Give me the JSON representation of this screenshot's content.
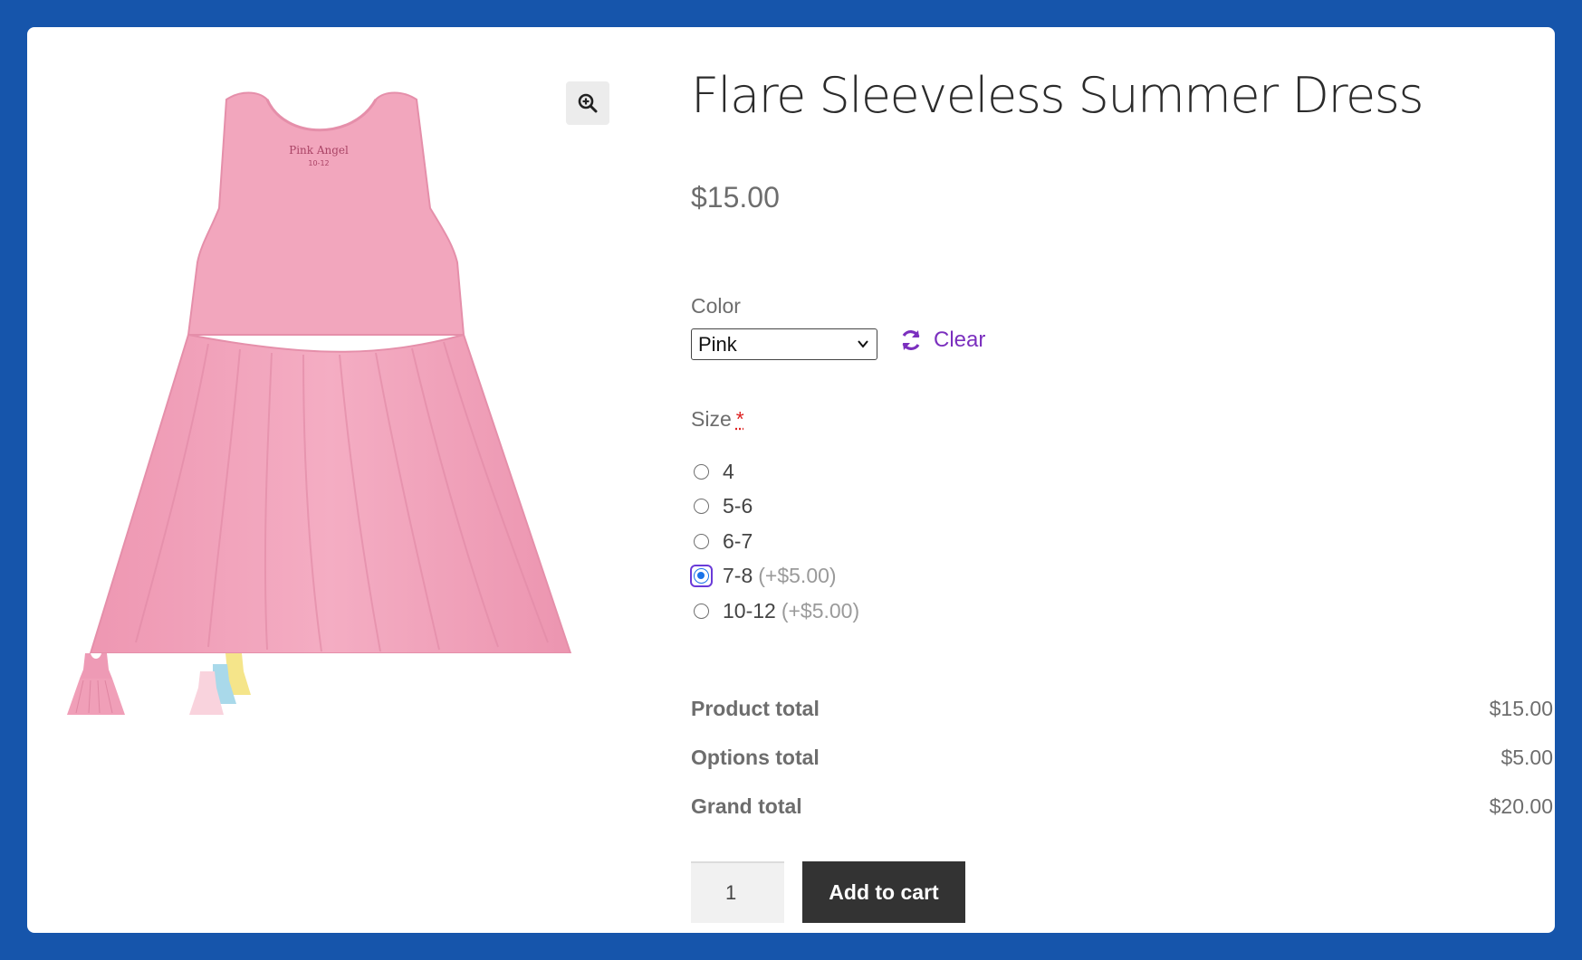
{
  "product": {
    "title": "Flare Sleeveless Summer Dress",
    "price": "$15.00",
    "main_image_icon": "pink-dress-image",
    "thumbnails": [
      {
        "icon": "pink-dress-thumbnail"
      },
      {
        "icon": "multicolor-dresses-thumbnail"
      }
    ],
    "zoom_icon": "zoom-in-icon"
  },
  "color": {
    "label": "Color",
    "selected": "Pink",
    "clear_label": "Clear",
    "clear_icon": "refresh-icon"
  },
  "size": {
    "label": "Size",
    "required_mark": "*",
    "options": [
      {
        "label": "4",
        "extra": "",
        "checked": false
      },
      {
        "label": "5-6",
        "extra": "",
        "checked": false
      },
      {
        "label": "6-7",
        "extra": "",
        "checked": false
      },
      {
        "label": "7-8",
        "extra": "(+$5.00)",
        "checked": true
      },
      {
        "label": "10-12",
        "extra": "(+$5.00)",
        "checked": false
      }
    ]
  },
  "totals": {
    "product_label": "Product total",
    "product_value": "$15.00",
    "options_label": "Options total",
    "options_value": "$5.00",
    "grand_label": "Grand total",
    "grand_value": "$20.00"
  },
  "cart": {
    "quantity": "1",
    "add_label": "Add to cart"
  },
  "colors": {
    "background": "#1655AB",
    "dress_pink": "#F2A7BE",
    "link_purple": "#7B2FBE",
    "button_dark": "#333333"
  }
}
